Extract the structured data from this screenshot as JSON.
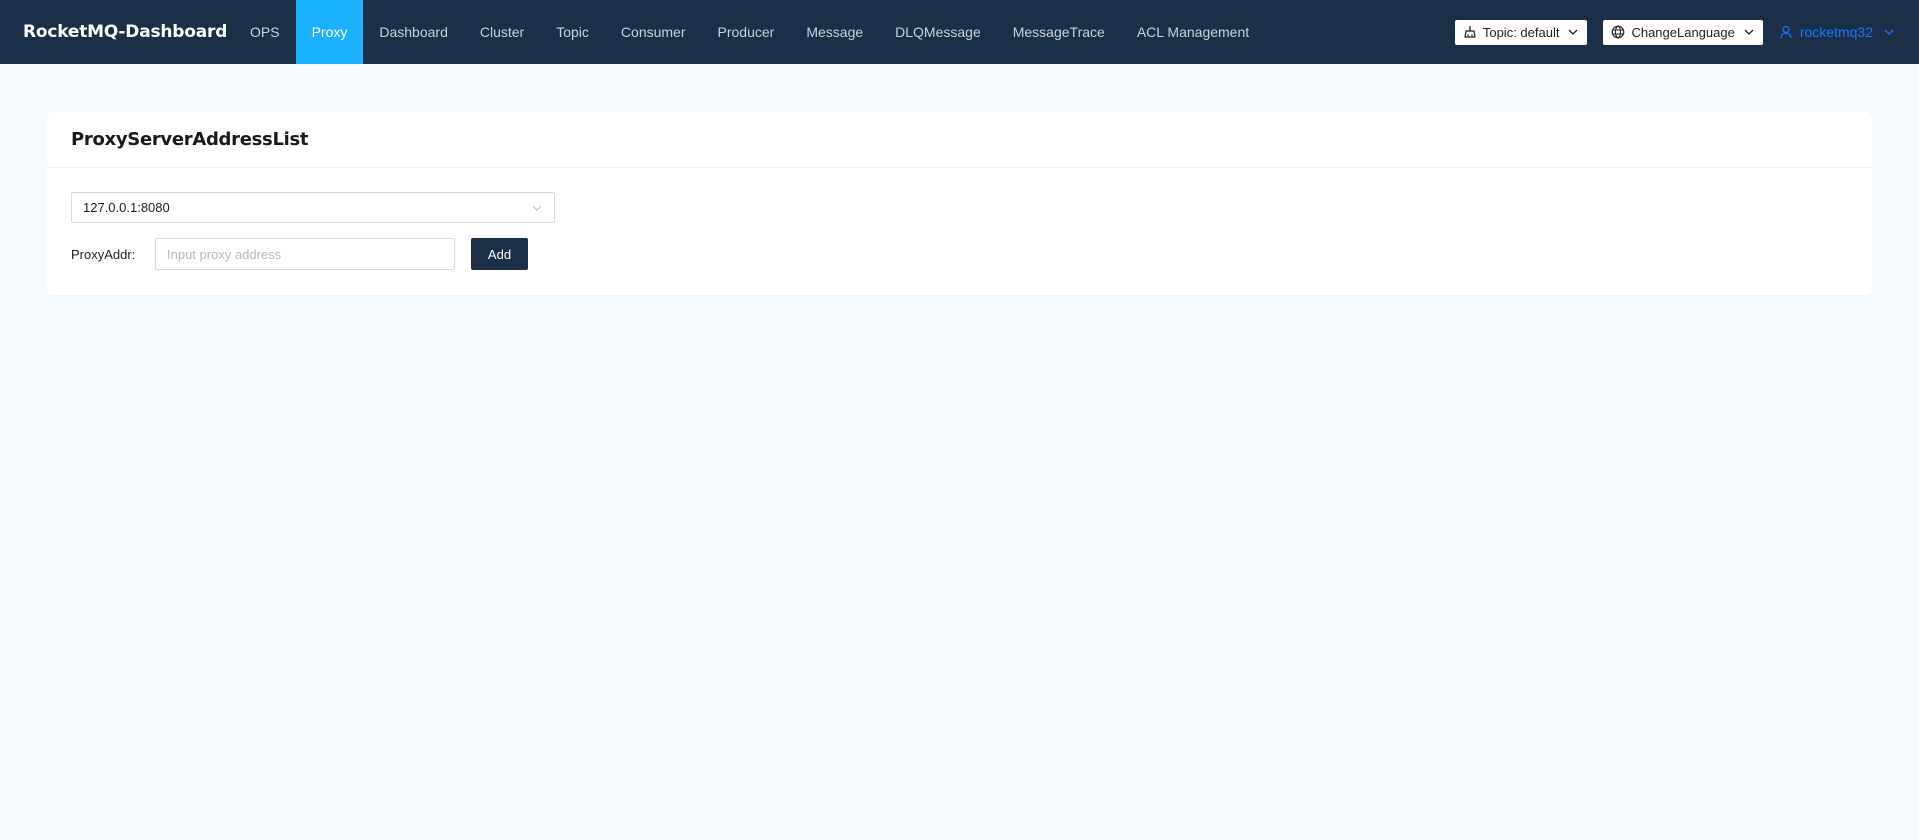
{
  "header": {
    "brand": "RocketMQ-Dashboard",
    "nav": [
      {
        "label": "OPS",
        "active": false
      },
      {
        "label": "Proxy",
        "active": true
      },
      {
        "label": "Dashboard",
        "active": false
      },
      {
        "label": "Cluster",
        "active": false
      },
      {
        "label": "Topic",
        "active": false
      },
      {
        "label": "Consumer",
        "active": false
      },
      {
        "label": "Producer",
        "active": false
      },
      {
        "label": "Message",
        "active": false
      },
      {
        "label": "DLQMessage",
        "active": false
      },
      {
        "label": "MessageTrace",
        "active": false
      },
      {
        "label": "ACL Management",
        "active": false
      }
    ],
    "topic_selector": {
      "label": "Topic: default",
      "icon": "broom-icon"
    },
    "language_selector": {
      "label": "ChangeLanguage",
      "icon": "globe-icon"
    },
    "user": {
      "label": "rocketmq32",
      "icon": "user-icon"
    }
  },
  "card": {
    "title": "ProxyServerAddressList",
    "address_select": {
      "value": "127.0.0.1:8080"
    },
    "add_form": {
      "label": "ProxyAddr:",
      "placeholder": "Input proxy address",
      "value": "",
      "button_label": "Add"
    }
  },
  "colors": {
    "header_bg": "#1c2f49",
    "nav_active_bg": "#1ab2ff",
    "page_bg": "#f5fafe",
    "user_link": "#1677ff",
    "button_bg": "#1c2f49"
  }
}
